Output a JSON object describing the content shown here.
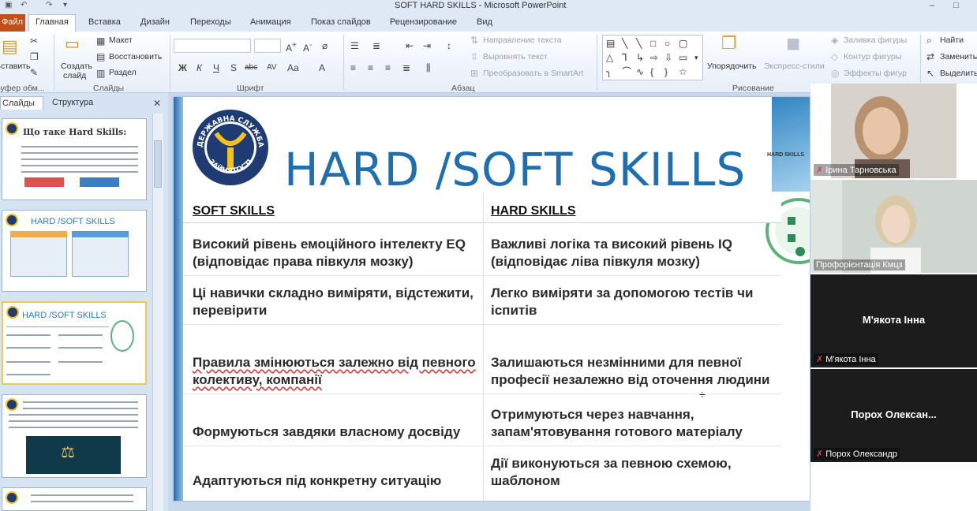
{
  "window": {
    "title": "SOFT  HARD SKILLS  -  Microsoft PowerPoint",
    "minimize": "–",
    "maximize": "□"
  },
  "ribbon_tabs": {
    "file": "Файл",
    "items": [
      "Главная",
      "Вставка",
      "Дизайн",
      "Переходы",
      "Анимация",
      "Показ слайдов",
      "Рецензирование",
      "Вид"
    ]
  },
  "ribbon": {
    "paste": "Вставить",
    "clipboard_group": "Буфер обм...",
    "new_slide": [
      "Создать",
      "слайд"
    ],
    "layout": "Макет",
    "reset": "Восстановить",
    "section": "Раздел",
    "slides_group": "Слайды",
    "font_group": "Шрифт",
    "font_buttons": [
      "Ж",
      "К",
      "Ч",
      "S",
      "abc",
      "AV",
      "Aa"
    ],
    "paragraph_group": "Абзац",
    "text_direction": "Направление текста",
    "align_text": "Выровнять текст",
    "convert_smartart": "Преобразовать в SmartArt",
    "arrange": "Упорядочить",
    "quick_styles": "Экспресс-стили",
    "drawing_group": "Рисование",
    "shape_fill": "Заливка фигуры",
    "shape_outline": "Контур фигуры",
    "shape_effects": "Эффекты фигур",
    "find": "Найти",
    "replace": "Заменить",
    "select": "Выделить"
  },
  "slide_pane": {
    "tabs": [
      "Слайды",
      "Структура"
    ],
    "thumbnails": [
      {
        "number": "",
        "title": "Що таке Hard Skills:"
      },
      {
        "number": "",
        "title": "HARD /SOFT SKILLS"
      },
      {
        "number": "",
        "title": "HARD /SOFT SKILLS"
      },
      {
        "number": "",
        "title": ""
      },
      {
        "number": "",
        "title": ""
      }
    ]
  },
  "slide": {
    "title": "HARD  /SOFT SKILLS",
    "logo_top_text": "ДЕРЖАВНА СЛУЖБА",
    "logo_bottom_text": "ЗАЙНЯТОСТІ",
    "side_mini_title": "HARD SKILLS",
    "table": {
      "headers": [
        "SOFT SKILLS",
        "HARD SKILLS"
      ],
      "rows": [
        [
          "Високий рівень емоційного інтелекту EQ (відповідає права півкуля мозку)",
          "Важливі логіка та високий рівень IQ (відповідає ліва півкуля мозку)"
        ],
        [
          "Ці навички складно виміряти, відстежити, перевірити",
          "Легко виміряти за допомогою тестів чи іспитів"
        ],
        [
          "Правила змінюються залежно від певного колективу, компанії",
          "Залишаються незмінними для певної професії незалежно від оточення людини"
        ],
        [
          "Формуються завдяки власному досвіду",
          "Отримуються через навчання, запам'ятовування готового матеріалу"
        ],
        [
          "Адаптуються під конкретну ситуацію",
          "Дії виконуються за певною схемою, шаблоном"
        ]
      ]
    }
  },
  "video_tiles": [
    {
      "name": "Ірина Тарновська",
      "center": ""
    },
    {
      "name": "Профорієнтація Кмцз",
      "center": ""
    },
    {
      "name": "М'якота Інна",
      "center": "М'якота Інна"
    },
    {
      "name": "Порох Олександр",
      "center": "Порох  Олексан..."
    }
  ],
  "colors": {
    "accent": "#1f6eb0",
    "file_tab": "#c24e18",
    "ribbon_bg": "#dfe9f5",
    "logo_navy": "#1e3b73",
    "logo_gold": "#f4c21a"
  }
}
